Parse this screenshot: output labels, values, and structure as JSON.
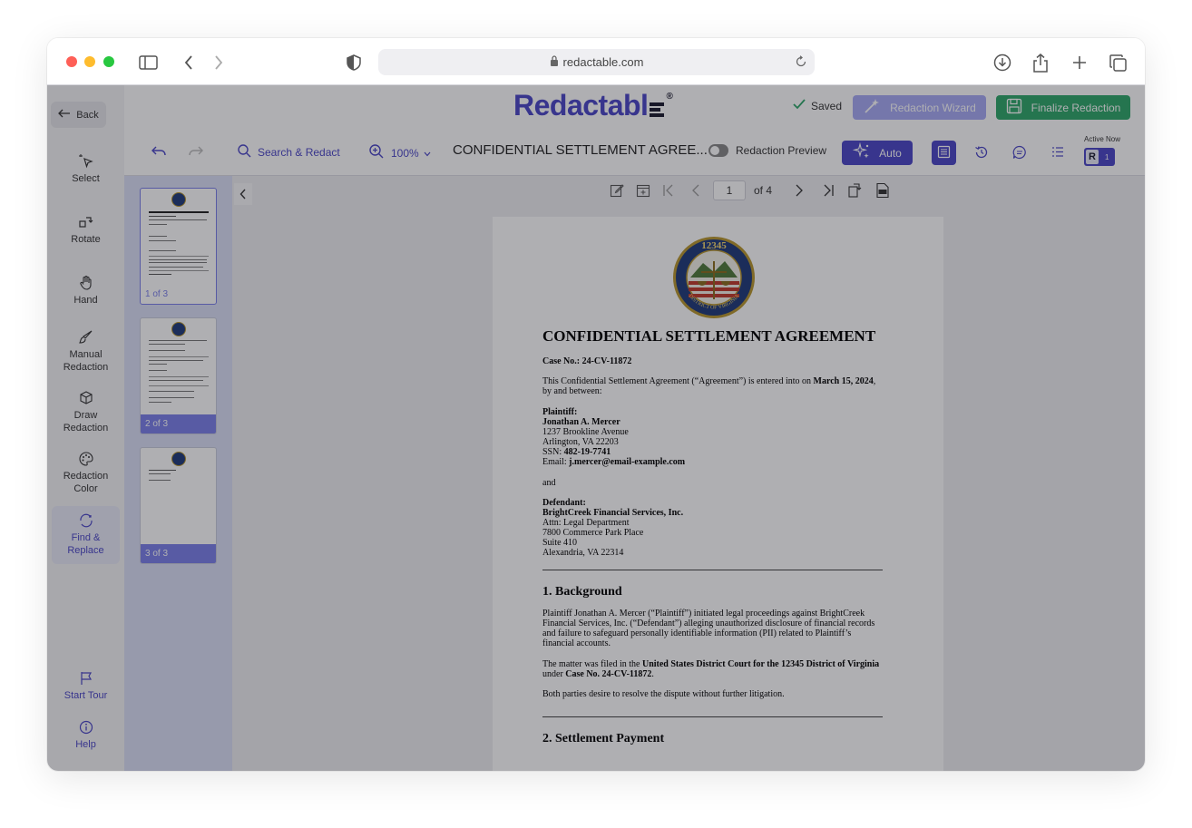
{
  "browser": {
    "url": "redactable.com"
  },
  "app": {
    "logo": "Redactabl",
    "logo_suffix": "®",
    "saved_label": "Saved",
    "wizard_label": "Redaction Wizard",
    "finalize_label": "Finalize Redaction",
    "back_label": "Back"
  },
  "sidebar": {
    "tools": [
      {
        "label": "Select"
      },
      {
        "label": "Rotate"
      },
      {
        "label": "Hand"
      },
      {
        "label": "Manual Redaction"
      },
      {
        "label": "Draw Redaction"
      },
      {
        "label": "Redaction Color"
      },
      {
        "label": "Find & Replace"
      }
    ],
    "start_tour": "Start Tour",
    "help": "Help"
  },
  "toolbar": {
    "search_label": "Search & Redact",
    "zoom": "100%",
    "doc_title": "CONFIDENTIAL SETTLEMENT AGREE...",
    "preview_label": "Redaction Preview",
    "auto_label": "Auto",
    "active_now_label": "Active Now",
    "avatar_letter": "R",
    "active_count": "1"
  },
  "thumbnails": [
    {
      "label": "1 of 3"
    },
    {
      "label": "2 of 3"
    },
    {
      "label": "3 of 3"
    }
  ],
  "pager": {
    "current": "1",
    "total_label": "of 4"
  },
  "seal": {
    "number": "12345",
    "text": "DISTRICT OF VIRGINIA"
  },
  "document": {
    "title": "CONFIDENTIAL SETTLEMENT AGREEMENT",
    "case_no": "Case No.: 24-CV-11872",
    "intro_pre": "This Confidential Settlement Agreement (“Agreement”) is entered into on ",
    "intro_date": "March 15, 2024",
    "intro_post": ", by and between:",
    "plaintiff_heading": "Plaintiff:",
    "plaintiff_name": "Jonathan A. Mercer",
    "plaintiff_addr1": "1237 Brookline Avenue",
    "plaintiff_addr2": "Arlington, VA 22203",
    "ssn_label": "SSN: ",
    "ssn_value": "482-19-7741",
    "email_label": "Email: ",
    "email_value": "j.mercer@email-example.com",
    "and": "and",
    "defendant_heading": "Defendant:",
    "defendant_name": "BrightCreek Financial Services, Inc.",
    "defendant_attn": "Attn: Legal Department",
    "defendant_addr1": "7800 Commerce Park Place",
    "defendant_addr2": "Suite 410",
    "defendant_addr3": "Alexandria, VA 22314",
    "section1_title": "1. Background",
    "section1_p1": "Plaintiff Jonathan A. Mercer (“Plaintiff”) initiated legal proceedings against BrightCreek Financial Services, Inc. (“Defendant”) alleging unauthorized disclosure of financial records and failure to safeguard personally identifiable information (PII) related to Plaintiff’s financial accounts.",
    "section1_p2_pre": "The matter was filed in the ",
    "section1_p2_court": "United States District Court for the 12345 District of Virginia",
    "section1_p2_mid": " under ",
    "section1_p2_case": "Case No. 24-CV-11872",
    "section1_p2_post": ".",
    "section1_p3": "Both parties desire to resolve the dispute without further litigation.",
    "section2_title": "2. Settlement Payment"
  },
  "colors": {
    "brand": "#4b47c7",
    "accent": "#7b80ea",
    "green": "#2ea86a"
  }
}
